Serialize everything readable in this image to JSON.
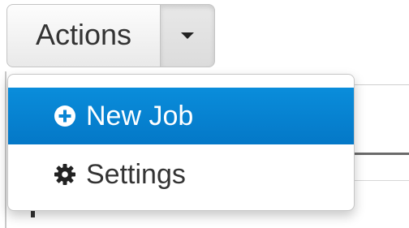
{
  "actions_button": {
    "label": "Actions",
    "caret_icon": "caret-down-icon"
  },
  "dropdown": {
    "items": [
      {
        "label": "New Job",
        "icon": "plus-circle-icon",
        "active": true
      },
      {
        "label": "Settings",
        "icon": "gear-icon",
        "active": false
      }
    ]
  },
  "colors": {
    "active_item_bg": "#0a86d4",
    "text": "#333333"
  }
}
